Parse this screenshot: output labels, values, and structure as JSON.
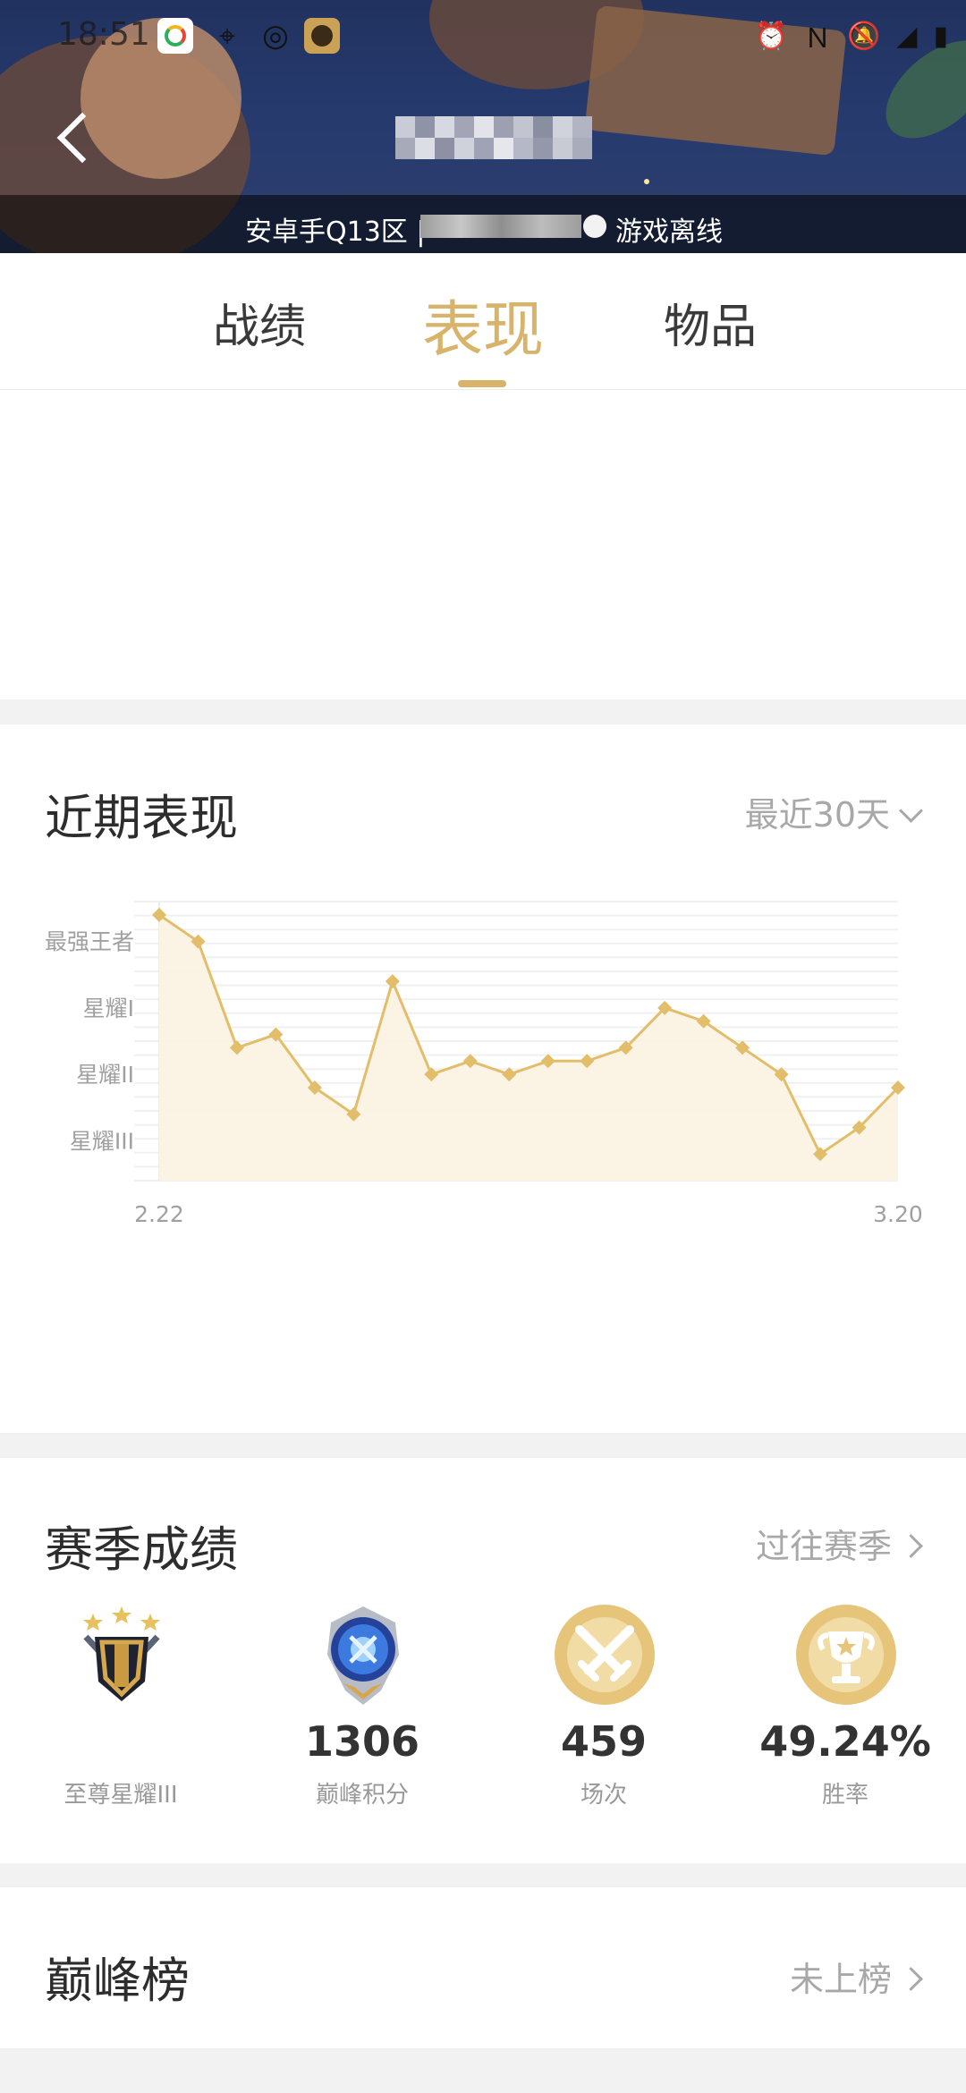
{
  "status_bar": {
    "time": "18:51",
    "right_icons": [
      "alarm-icon",
      "nfc-icon",
      "mute-icon",
      "signal-icon",
      "battery-icon"
    ]
  },
  "header": {
    "server": "安卓手Q13区 |",
    "status_text": "游戏离线"
  },
  "tabs": [
    "战绩",
    "表现",
    "物品"
  ],
  "active_tab": "表现",
  "accent_color": "#d8b36a",
  "recent": {
    "title": "近期表现",
    "filter": "最近30天"
  },
  "chart_data": {
    "type": "line",
    "y_tick_labels": [
      "最强王者",
      "星耀I",
      "星耀II",
      "星耀III"
    ],
    "x_tick_labels": [
      "2.22",
      "3.20"
    ],
    "y_scale_note": "rank levels: 星耀III=1, 星耀II=2, 星耀I=3, 最强王者=4",
    "values": [
      4.4,
      4.0,
      2.4,
      2.6,
      1.8,
      1.4,
      3.4,
      2.0,
      2.2,
      2.0,
      2.2,
      2.2,
      2.4,
      3.0,
      2.8,
      2.4,
      2.0,
      0.8,
      1.2,
      1.8
    ],
    "line_color": "#e2bd6a",
    "fill_color": "#fbf3e2"
  },
  "season": {
    "title": "赛季成绩",
    "link": "过往赛季",
    "stats": [
      {
        "value": "",
        "label": "至尊星耀III"
      },
      {
        "value": "1306",
        "label": "巅峰积分"
      },
      {
        "value": "459",
        "label": "场次"
      },
      {
        "value": "49.24%",
        "label": "胜率"
      }
    ]
  },
  "peak": {
    "title": "巅峰榜",
    "status": "未上榜"
  }
}
